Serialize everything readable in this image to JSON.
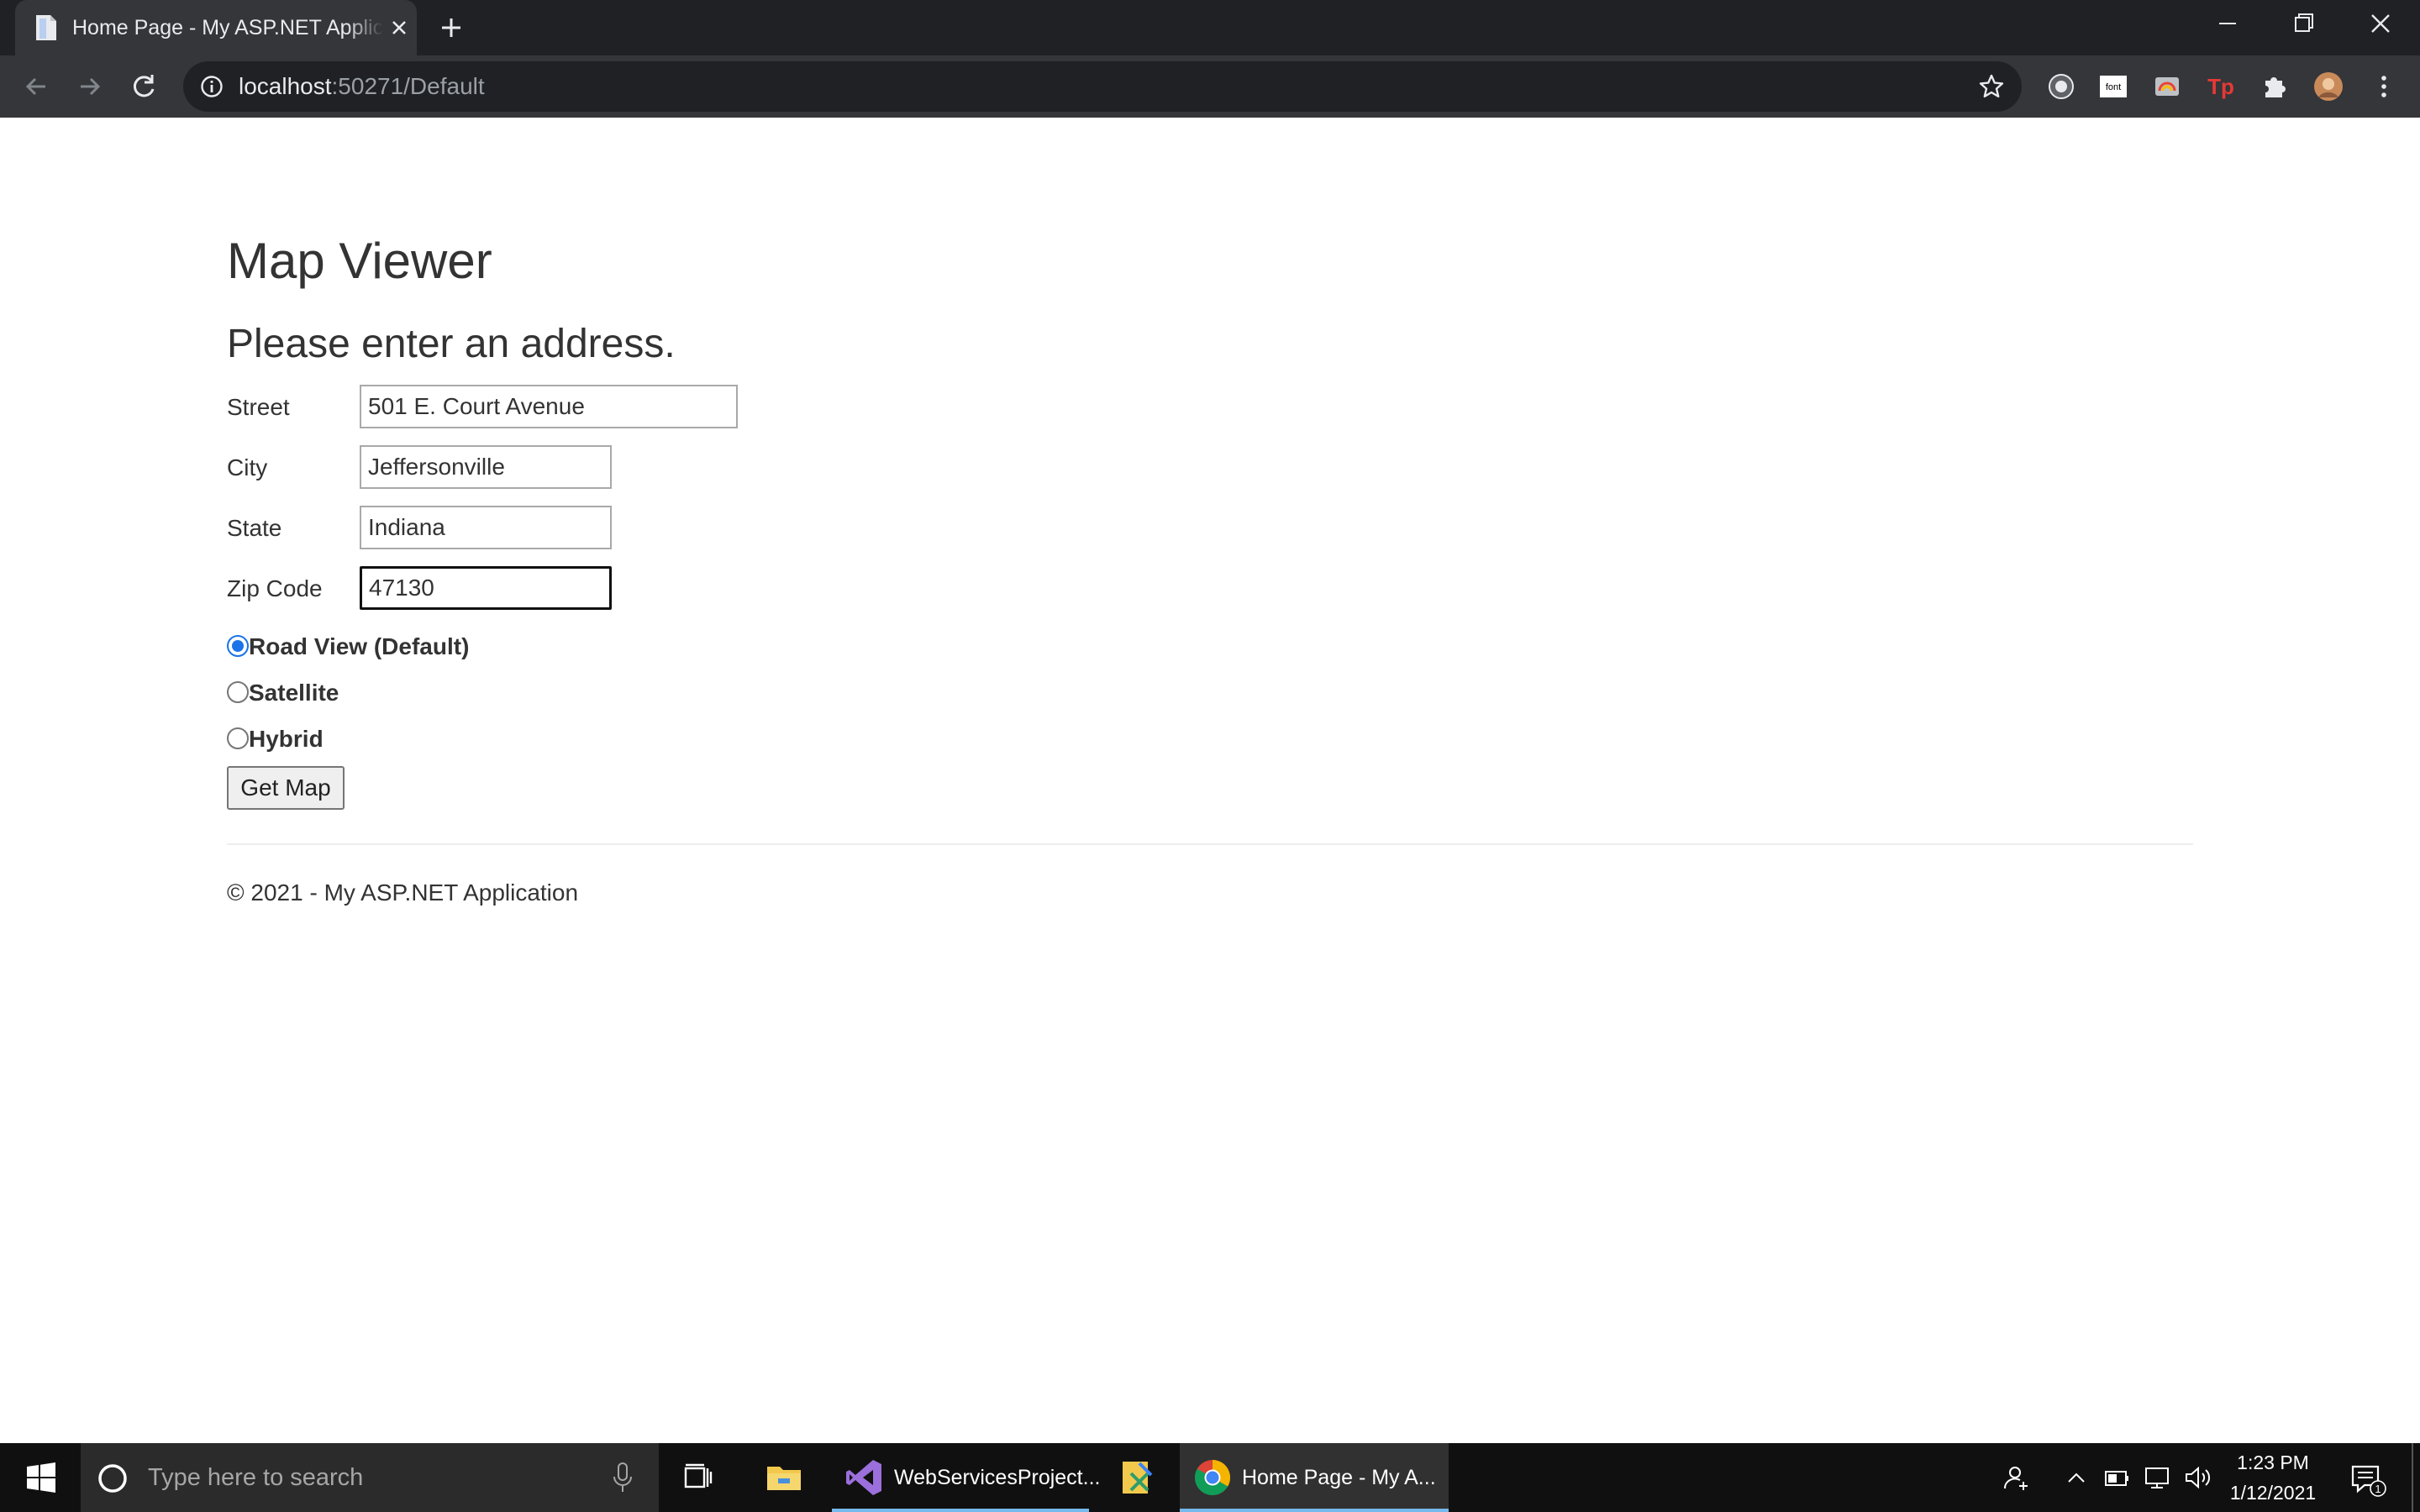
{
  "browser": {
    "tab_title": "Home Page - My ASP.NET Application",
    "url_host": "localhost",
    "url_rest": ":50271/Default"
  },
  "page": {
    "title": "Map Viewer",
    "subtitle": "Please enter an address.",
    "fields": [
      {
        "label": "Street",
        "value": "501 E. Court Avenue"
      },
      {
        "label": "City",
        "value": "Jeffersonville"
      },
      {
        "label": "State",
        "value": "Indiana"
      },
      {
        "label": "Zip Code",
        "value": "47130"
      }
    ],
    "view_options": [
      {
        "label": "Road View (Default)",
        "checked": true
      },
      {
        "label": "Satellite",
        "checked": false
      },
      {
        "label": "Hybrid",
        "checked": false
      }
    ],
    "submit_label": "Get Map",
    "footer": "© 2021 - My ASP.NET Application"
  },
  "taskbar": {
    "search_placeholder": "Type here to search",
    "apps": [
      {
        "label": "WebServicesProject...",
        "icon": "visual-studio-icon"
      },
      {
        "label": "Home Page - My A...",
        "icon": "chrome-icon"
      }
    ],
    "time": "1:23 PM",
    "date": "1/12/2021",
    "notification_count": "1"
  },
  "colors": {
    "chrome_dark": "#202124",
    "chrome_toolbar": "#35363a",
    "radio_accent": "#1a73e8",
    "taskbar": "#101010"
  }
}
